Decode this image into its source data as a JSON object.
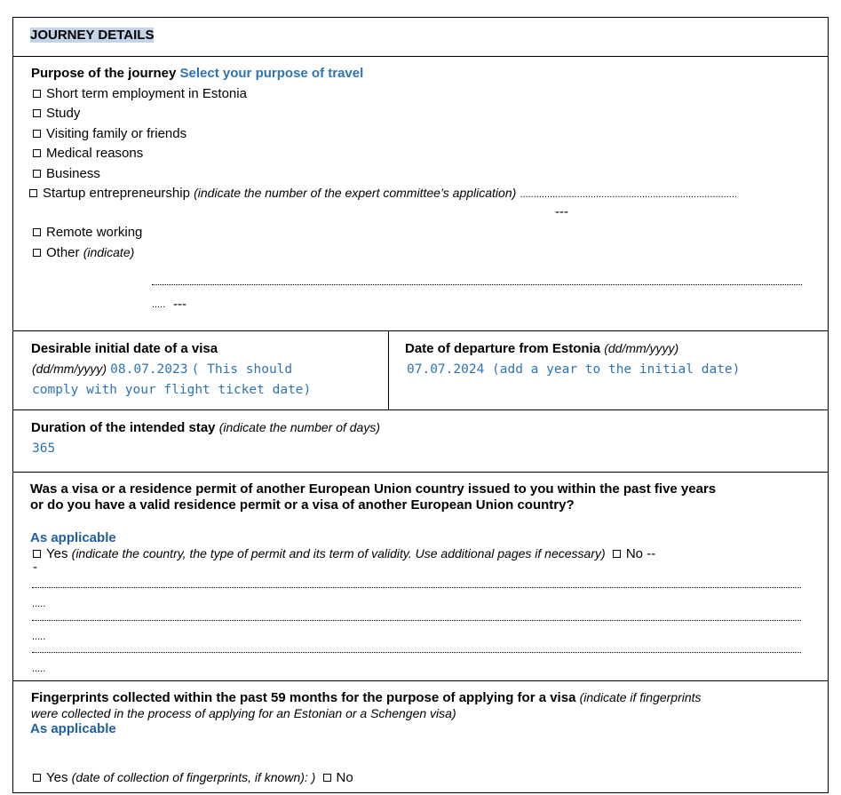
{
  "header": {
    "title": "JOURNEY DETAILS"
  },
  "purpose": {
    "label": "Purpose of the journey",
    "hint": "Select your purpose of travel",
    "options": [
      "Short term employment in Estonia",
      "Study",
      "Visiting family or friends",
      "Medical reasons",
      "Business"
    ],
    "startup_label": "Startup entrepreneurship",
    "startup_note": "(indicate the number of the expert committee’s application)",
    "startup_dots": "................................................................................",
    "startup_dash": "---",
    "remote": "Remote working",
    "other_label": "Other",
    "other_note": "(indicate)",
    "other_dots_end": ".....",
    "other_dash": "---"
  },
  "dates": {
    "initial_label": "Desirable initial date of a visa",
    "initial_format": "(dd/mm/yyyy)",
    "initial_value": "08.07.2023",
    "initial_comment_1": "( This should",
    "initial_comment_2": "comply with your flight ticket date)",
    "departure_label": "Date of departure from Estonia",
    "departure_format": "(dd/mm/yyyy)",
    "departure_value": "07.07.2024 (add a year to the initial date)"
  },
  "duration": {
    "label": "Duration of the intended stay",
    "note": "(indicate the number of days)",
    "value": "365"
  },
  "prior_visa": {
    "question_1": "Was a visa or a residence permit of another European Union country issued to you within the past five years",
    "question_2": "or  do you have a valid residence permit or a visa of another European Union country?",
    "answer": "As applicable",
    "yes_label": "Yes",
    "yes_note": "(indicate the country, the type of permit and its term of validity. Use additional pages if necessary)",
    "no_label": "No",
    "no_dash": "--",
    "dash_cont": "-",
    "dots_end": "....."
  },
  "fingerprints": {
    "label": "Fingerprints collected within the past 59 months for the purpose of applying for a visa",
    "note_1": "(indicate if fingerprints",
    "note_2": "were  collected in the process of applying for an Estonian or a Schengen visa)",
    "answer": "As applicable",
    "yes_label": "Yes",
    "yes_note": "(date of collection of fingerprints, if known): )",
    "no_label": "No"
  }
}
